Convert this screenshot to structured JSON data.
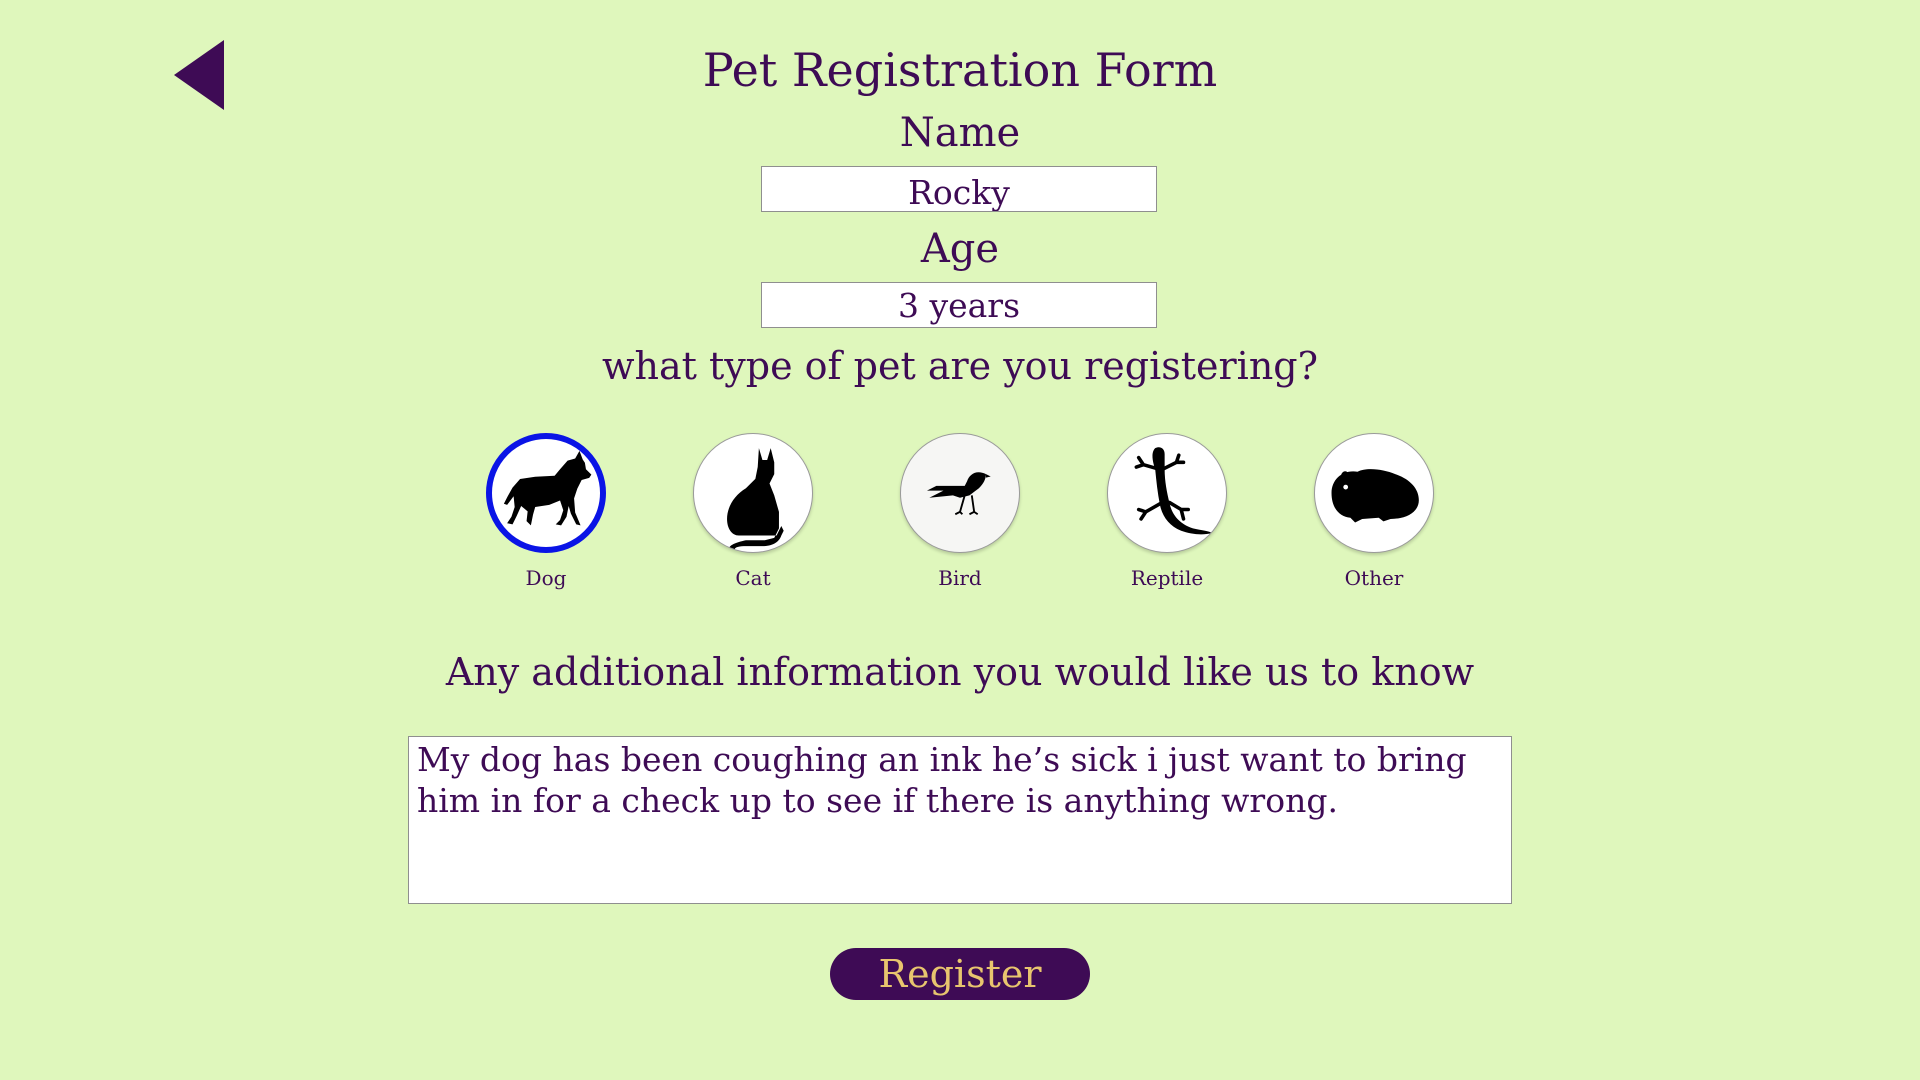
{
  "app": {
    "title": "Pet Registration Form",
    "background_color": "#dff7bc",
    "text_color": "#3e0b55",
    "accent_color": "#3e0b55",
    "selection_color": "#0a14e6",
    "button_text_color": "#e8c56e"
  },
  "nav": {
    "back_icon": "back-triangle-icon"
  },
  "form": {
    "name": {
      "label": "Name",
      "value": "Rocky"
    },
    "age": {
      "label": "Age",
      "value": "3 years"
    },
    "pet_type": {
      "question": "what type of pet are you registering?",
      "selected": "Dog",
      "options": [
        {
          "label": "Dog",
          "icon": "dog-icon",
          "selected": true
        },
        {
          "label": "Cat",
          "icon": "cat-icon",
          "selected": false
        },
        {
          "label": "Bird",
          "icon": "bird-icon",
          "selected": false
        },
        {
          "label": "Reptile",
          "icon": "lizard-icon",
          "selected": false
        },
        {
          "label": "Other",
          "icon": "guinea-pig-icon",
          "selected": false
        }
      ]
    },
    "additional_info": {
      "label": "Any additional information you would like us to know",
      "value": "My dog has been coughing an ink he’s sick i just want to bring him in for a check up to see if there is anything wrong."
    },
    "register_label": "Register"
  }
}
